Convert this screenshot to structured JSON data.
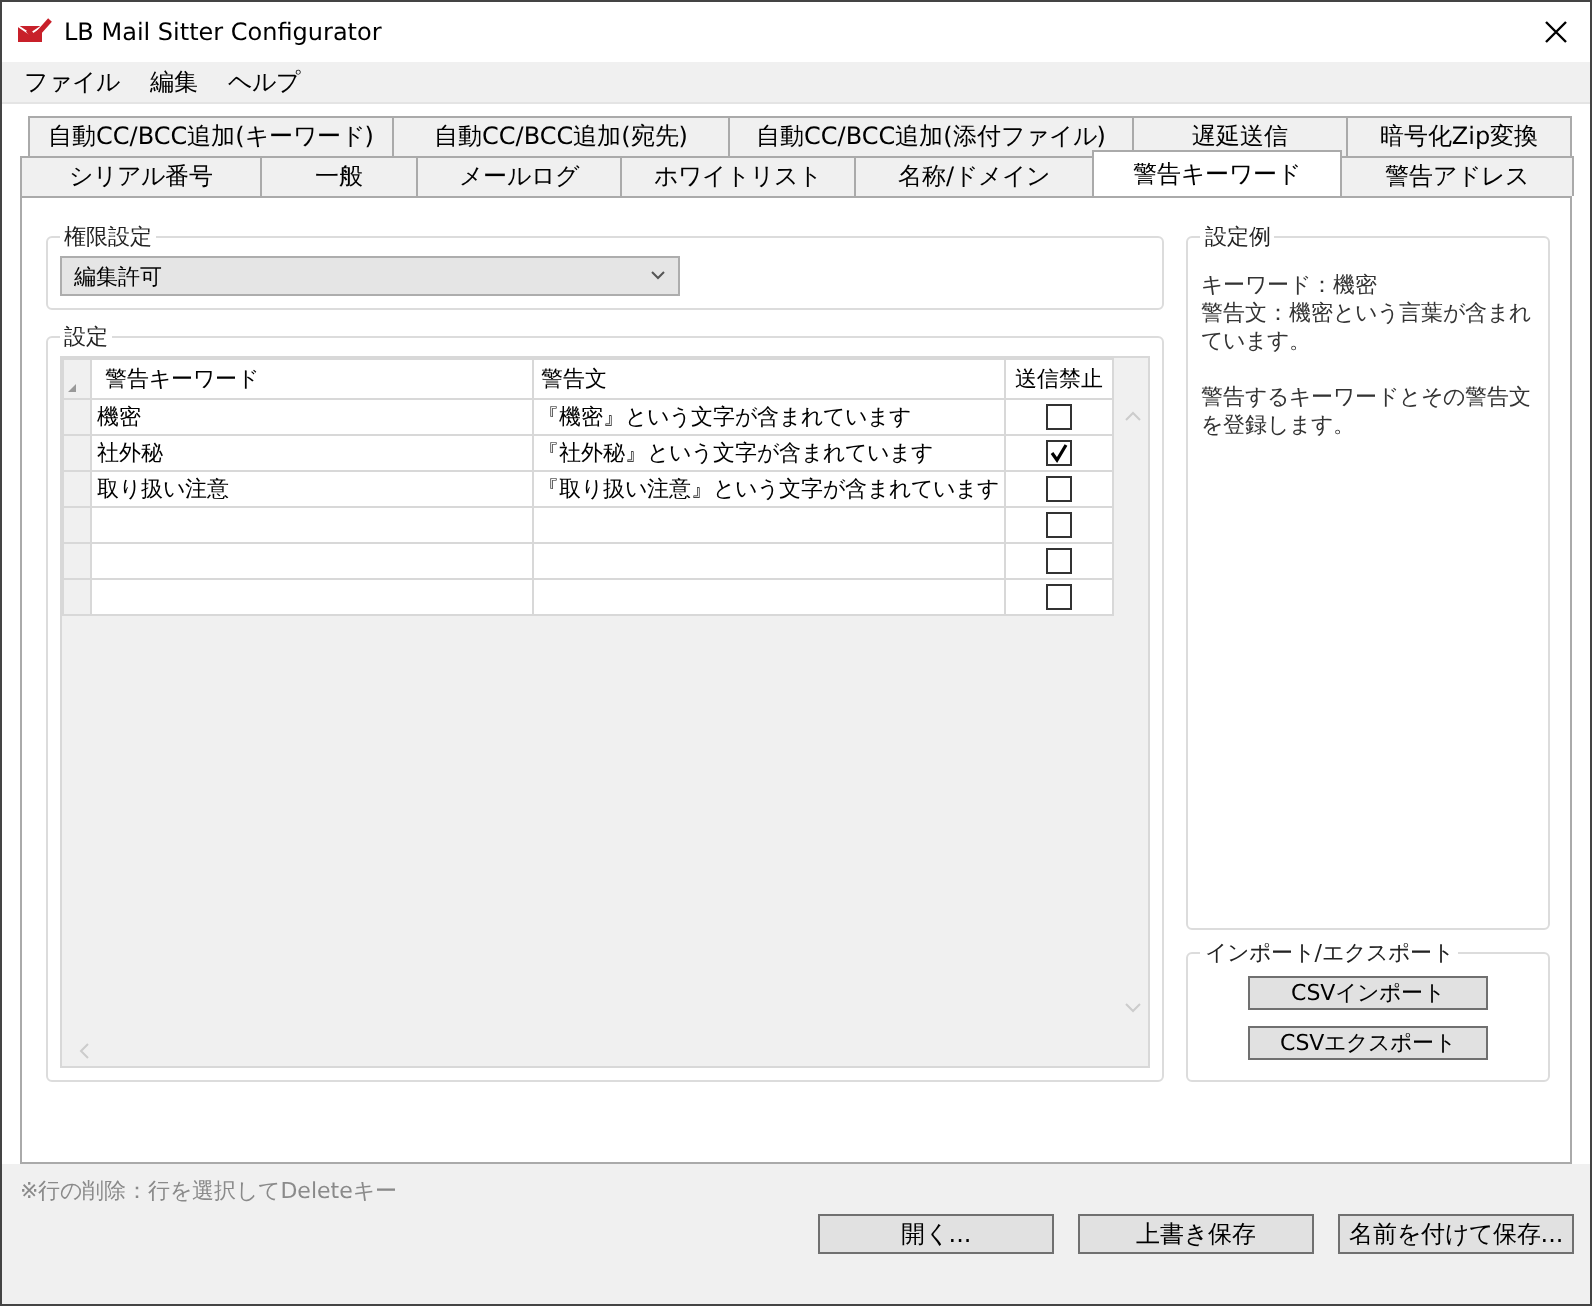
{
  "window": {
    "title": "LB Mail Sitter Configurator"
  },
  "menu": [
    "ファイル",
    "編集",
    "ヘルプ"
  ],
  "tab_rows": [
    [
      {
        "label": "自動CC/BCC追加(キーワード)",
        "selected": false
      },
      {
        "label": "自動CC/BCC追加(宛先)",
        "selected": false
      },
      {
        "label": "自動CC/BCC追加(添付ファイル)",
        "selected": false
      },
      {
        "label": "遅延送信",
        "selected": false
      },
      {
        "label": "暗号化Zip変換",
        "selected": false
      }
    ],
    [
      {
        "label": "シリアル番号",
        "selected": false
      },
      {
        "label": "一般",
        "selected": false
      },
      {
        "label": "メールログ",
        "selected": false
      },
      {
        "label": "ホワイトリスト",
        "selected": false
      },
      {
        "label": "名称/ドメイン",
        "selected": false
      },
      {
        "label": "警告キーワード",
        "selected": true
      },
      {
        "label": "警告アドレス",
        "selected": false
      }
    ]
  ],
  "permission": {
    "title": "権限設定",
    "value": "編集許可"
  },
  "settings": {
    "title": "設定",
    "columns": [
      "警告キーワード",
      "警告文",
      "送信禁止"
    ],
    "rows": [
      {
        "keyword": "機密",
        "message": "『機密』という文字が含まれています",
        "blocked": false
      },
      {
        "keyword": "社外秘",
        "message": "『社外秘』という文字が含まれています",
        "blocked": true
      },
      {
        "keyword": "取り扱い注意",
        "message": "『取り扱い注意』という文字が含まれています",
        "blocked": false
      },
      {
        "blocked": false
      },
      {
        "blocked": false
      },
      {
        "blocked": false
      }
    ]
  },
  "example": {
    "title": "設定例",
    "lines": [
      "キーワード：機密",
      "警告文：機密という言葉が含まれています。"
    ],
    "note": "警告するキーワードとその警告文を登録します。"
  },
  "import_export": {
    "title": "インポート/エクスポート",
    "buttons": [
      "CSVインポート",
      "CSVエクスポート"
    ]
  },
  "hint": "※行の削除：行を選択してDeleteキー",
  "buttons": [
    "開く...",
    "上書き保存",
    "名前を付けて保存..."
  ]
}
